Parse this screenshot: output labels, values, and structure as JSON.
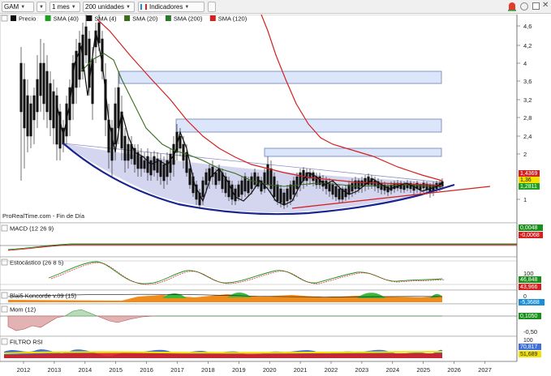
{
  "toolbar": {
    "symbol": "GAM",
    "period": "1 mes",
    "units": "200 unidades",
    "indicators_label": "Indicadores"
  },
  "legend": [
    {
      "label": "Precio",
      "color": "#111111"
    },
    {
      "label": "SMA (40)",
      "color": "#1f9e1f"
    },
    {
      "label": "SMA (4)",
      "color": "#111111"
    },
    {
      "label": "SMA (20)",
      "color": "#3a6d1a"
    },
    {
      "label": "SMA (200)",
      "color": "#2a7a2a"
    },
    {
      "label": "SMA (120)",
      "color": "#d42020"
    }
  ],
  "source_text": "ProRealTime.com - Fin de Día",
  "price_axis": [
    "4,6",
    "4,2",
    "4",
    "3,6",
    "3,2",
    "2,8",
    "2,4",
    "2",
    "1"
  ],
  "price_badges": [
    "1,4369",
    "1,36",
    "1,2811"
  ],
  "panels": {
    "macd": {
      "label": "MACD (12 26 9)",
      "values": [
        "0,0048",
        "-0,0068"
      ]
    },
    "stoch": {
      "label": "Estocástico (26 8 5)",
      "axis": "100",
      "values": [
        "46,848",
        "43,966"
      ]
    },
    "blai5": {
      "label": "Blai5 Koncorde v.09 (15)",
      "values": [
        "0",
        "-5,3688"
      ]
    },
    "mom": {
      "label": "Mom (12)",
      "values": [
        "0,1050",
        "-0,50"
      ]
    },
    "rsi": {
      "label": "FILTRO RSI",
      "values": [
        "100",
        "70,817",
        "51,689"
      ]
    }
  },
  "x_axis": [
    "2012",
    "2013",
    "2014",
    "2015",
    "2016",
    "2017",
    "2018",
    "2019",
    "2020",
    "2021",
    "2022",
    "2023",
    "2024",
    "2025",
    "2026",
    "2027"
  ],
  "colors": {
    "sma120": "#d42020",
    "sma20": "#3a6d1a",
    "sma40": "#1f9e1f",
    "trend_curve": "#1a2590",
    "box_fill": "#dbe6fb",
    "box_stroke": "#6c7fb6",
    "positive": "#3db83d",
    "negative": "#d84a4a",
    "koncorde_orange": "#f08c1c"
  },
  "icons": [
    "alarm-icon",
    "refresh-icon",
    "window-icon",
    "close-icon"
  ]
}
